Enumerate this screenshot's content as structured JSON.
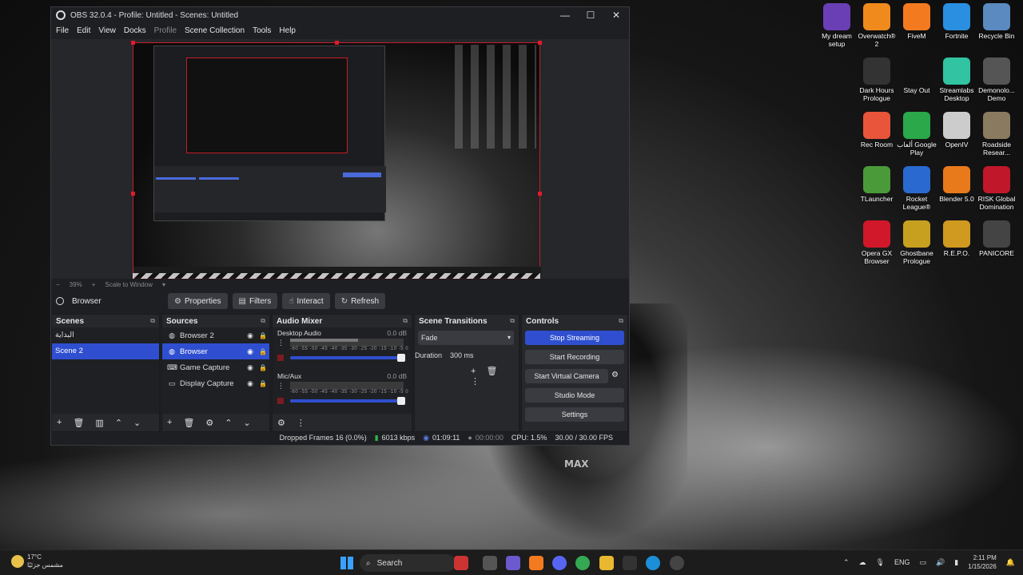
{
  "window": {
    "title": "OBS 32.0.4 - Profile: Untitled - Scenes: Untitled",
    "controls": [
      "—",
      "☐",
      "✕"
    ]
  },
  "menu": [
    "File",
    "Edit",
    "View",
    "Docks",
    "Profile",
    "Scene Collection",
    "Tools",
    "Help"
  ],
  "preview": {
    "zoom": "39%",
    "scale": "Scale to Window"
  },
  "toolbar": {
    "source": "Browser",
    "properties": "Properties",
    "filters": "Filters",
    "interact": "Interact",
    "refresh": "Refresh"
  },
  "scenes": {
    "title": "Scenes",
    "items": [
      "البداية",
      "Scene 2"
    ],
    "selected": "Scene 2"
  },
  "sources": {
    "title": "Sources",
    "items": [
      {
        "label": "Browser 2",
        "icon": "globe-icon"
      },
      {
        "label": "Browser",
        "icon": "globe-icon"
      },
      {
        "label": "Game Capture",
        "icon": "gamepad-icon"
      },
      {
        "label": "Display Capture",
        "icon": "monitor-icon"
      }
    ],
    "selected": "Browser"
  },
  "mixer": {
    "title": "Audio Mixer",
    "channels": [
      {
        "name": "Desktop Audio",
        "db": "0.0 dB"
      },
      {
        "name": "Mic/Aux",
        "db": "0.0 dB"
      }
    ],
    "ticks": "-60 -55 -50 -45 -40 -35 -30 -25 -20 -15 -10 -5 0"
  },
  "transitions": {
    "title": "Scene Transitions",
    "selected": "Fade",
    "duration_label": "Duration",
    "duration_value": "300 ms"
  },
  "controls": {
    "title": "Controls",
    "stop_streaming": "Stop Streaming",
    "start_recording": "Start Recording",
    "start_virtual_camera": "Start Virtual Camera",
    "studio_mode": "Studio Mode",
    "settings": "Settings"
  },
  "status": {
    "dropped": "Dropped Frames 16 (0.0%)",
    "bitrate": "6013 kbps",
    "stream_time": "01:09:11",
    "rec_time": "00:00:00",
    "cpu": "CPU: 1.5%",
    "fps": "30.00 / 30.00 FPS"
  },
  "desktop_icons": [
    {
      "label": "My dream setup",
      "color": "#6a3fb5"
    },
    {
      "label": "Overwatch® 2",
      "color": "#f08a1c"
    },
    {
      "label": "FiveM",
      "color": "#f47a20"
    },
    {
      "label": "Fortnite",
      "color": "#2a8fe0"
    },
    {
      "label": "Recycle Bin",
      "color": "#5a8ac0"
    },
    {
      "label": "Dark Hours Prologue",
      "color": "#333333"
    },
    {
      "label": "Stay Out",
      "color": "#111111"
    },
    {
      "label": "Streamlabs Desktop",
      "color": "#31c3a2"
    },
    {
      "label": "Demonolo... Demo",
      "color": "#555555"
    },
    {
      "label": "Rec Room",
      "color": "#e8553a"
    },
    {
      "label": "ألعاب Google Play",
      "color": "#2aa84a"
    },
    {
      "label": "OpenIV",
      "color": "#cccccc"
    },
    {
      "label": "Roadside Resear...",
      "color": "#8a7a60"
    },
    {
      "label": "TLauncher",
      "color": "#4a9a3a"
    },
    {
      "label": "Rocket League®",
      "color": "#2a6ad0"
    },
    {
      "label": "Blender 5.0",
      "color": "#e87a1c"
    },
    {
      "label": "RISK Global Domination",
      "color": "#c0182a"
    },
    {
      "label": "Opera GX Browser",
      "color": "#d0182a"
    },
    {
      "label": "Ghostbane Prologue",
      "color": "#c8a020"
    },
    {
      "label": "R.E.P.O.",
      "color": "#d09a20"
    },
    {
      "label": "PANICORE",
      "color": "#444444"
    }
  ],
  "taskbar": {
    "temp": "17°C",
    "weather": "مشمس جزئيًا",
    "search": "Search",
    "lang": "ENG",
    "time": "2:11 PM",
    "date": "1/15/2026"
  },
  "wallpaper_text": "MAX"
}
